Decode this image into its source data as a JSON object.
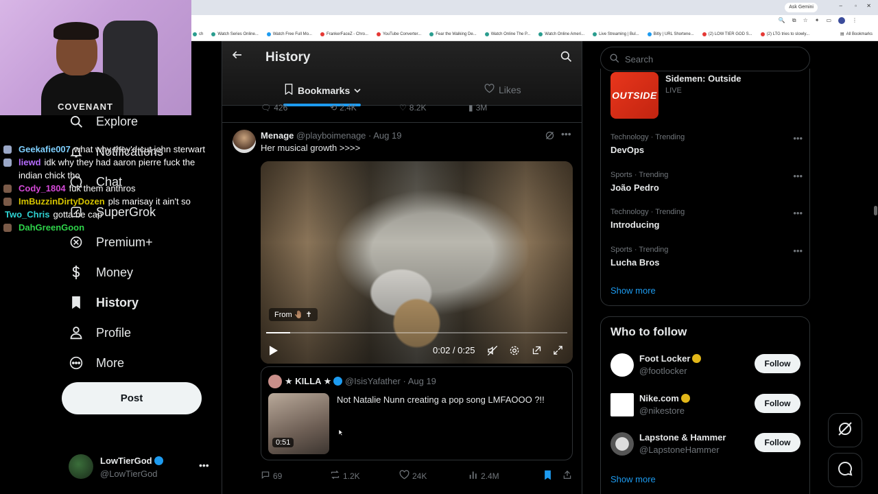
{
  "browser": {
    "gemini_label": "Ask Gemini",
    "bookmarks": [
      {
        "label": "ch",
        "color": "teal"
      },
      {
        "label": "Watch Series Online...",
        "color": "teal"
      },
      {
        "label": "Watch Free Full Mo...",
        "color": "teal"
      },
      {
        "label": "FrankerFaceZ - Chro...",
        "color": "teal"
      },
      {
        "label": "YouTube Converter...",
        "color": "teal"
      },
      {
        "label": "Fear the Walking De...",
        "color": "teal"
      },
      {
        "label": "Watch Online The P...",
        "color": "teal"
      },
      {
        "label": "Watch Online Ameri...",
        "color": "teal"
      },
      {
        "label": "Live Streaming | Bul...",
        "color": "teal"
      },
      {
        "label": "Bitly | URL Shortene...",
        "color": "teal"
      },
      {
        "label": "(2) LOW TIER GOD S...",
        "color": "red"
      },
      {
        "label": "(2) LTG tries to slowly...",
        "color": "red"
      }
    ],
    "all_bookmarks": "All Bookmarks"
  },
  "webcam": {
    "shirt_text": "COVENANT"
  },
  "chat": [
    {
      "user": "Geekafie007",
      "user_color": "#7fd0ff",
      "text": "what why they'd cut john sterwart",
      "badge": true
    },
    {
      "user": "liewd",
      "user_color": "#b56cff",
      "text": "idk why they had aaron pierre fuck the indian chick tho",
      "badge": true
    },
    {
      "user": "Cody_1804",
      "user_color": "#d54ad8",
      "text": "fuk them anthros",
      "badge": true
    },
    {
      "user": "ImBuzzinDirtyDozen",
      "user_color": "#d6c400",
      "text": "pls marisay it ain't so",
      "badge": true
    },
    {
      "user": "Two_Chris",
      "user_color": "#2ed3d3",
      "text": "gotta be cap",
      "badge": false
    },
    {
      "user": "DahGreenGoon",
      "user_color": "#2ed34a",
      "text": "",
      "badge": true
    }
  ],
  "nav": {
    "items": [
      {
        "label": "Explore",
        "icon": "search-icon"
      },
      {
        "label": "Notifications",
        "icon": "bell-icon"
      },
      {
        "label": "Chat",
        "icon": "chat-icon"
      },
      {
        "label": "SuperGrok",
        "icon": "grok-icon"
      },
      {
        "label": "Premium+",
        "icon": "x-icon"
      },
      {
        "label": "Money",
        "icon": "dollar-icon"
      },
      {
        "label": "History",
        "icon": "bookmark-icon"
      },
      {
        "label": "Profile",
        "icon": "person-icon"
      },
      {
        "label": "More",
        "icon": "more-circle-icon"
      }
    ],
    "post_label": "Post"
  },
  "account": {
    "name": "LowTierGod",
    "handle": "@LowTierGod"
  },
  "header": {
    "title": "History",
    "tabs": [
      {
        "label": "Bookmarks",
        "active": true
      },
      {
        "label": "Likes",
        "active": false
      }
    ]
  },
  "prev_stats": {
    "replies": "426",
    "reposts": "2.4K",
    "likes": "8.2K",
    "views": "3M"
  },
  "tweet": {
    "name": "Menage",
    "handle": "@playboimenage",
    "date": "Aug 19",
    "text": "Her musical growth >>>>",
    "video": {
      "from_label": "From 🤚🏽 ✝",
      "time": "0:02 / 0:25",
      "progress": 0.08
    },
    "quote": {
      "name": "★ KILLA ★",
      "handle": "@IsisYafather",
      "date": "Aug 19",
      "text": "Not Natalie Nunn creating a pop song LMFAOOO ?!!",
      "duration": "0:51"
    },
    "stats": {
      "replies": "69",
      "reposts": "1.2K",
      "likes": "24K",
      "views": "2.4M"
    }
  },
  "right": {
    "search_placeholder": "Search",
    "live": {
      "thumb": "OUTSIDE",
      "title": "Sidemen: Outside",
      "sub": "LIVE"
    },
    "trends": [
      {
        "category": "Technology · Trending",
        "name": "DevOps"
      },
      {
        "category": "Sports · Trending",
        "name": "João Pedro"
      },
      {
        "category": "Technology · Trending",
        "name": "Introducing"
      },
      {
        "category": "Sports · Trending",
        "name": "Lucha Bros"
      }
    ],
    "show_more": "Show more",
    "who_to_follow": {
      "title": "Who to follow",
      "accounts": [
        {
          "name": "Foot Locker",
          "handle": "@footlocker",
          "button": "Follow"
        },
        {
          "name": "Nike.com",
          "handle": "@nikestore",
          "button": "Follow"
        },
        {
          "name": "Lapstone & Hammer",
          "handle": "@LapstoneHammer",
          "button": "Follow"
        }
      ],
      "show_more": "Show more"
    }
  },
  "colors": {
    "accent": "#1d9bf0",
    "background": "#000000",
    "border": "#2f3336",
    "muted": "#71767b"
  }
}
